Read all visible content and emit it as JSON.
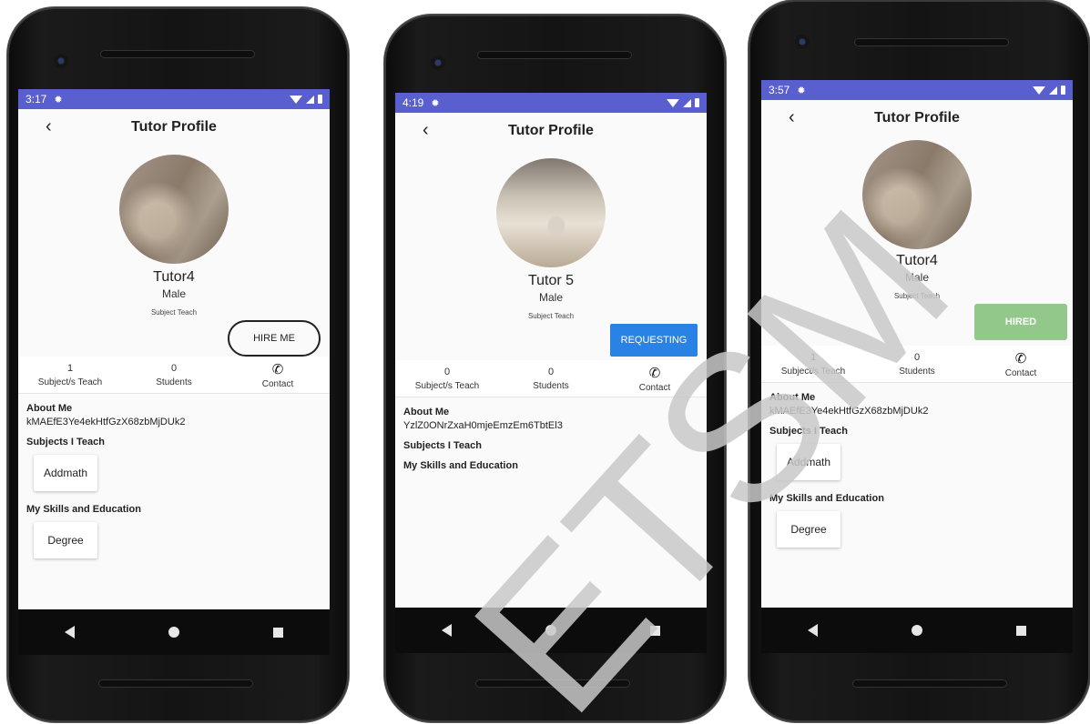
{
  "phones": [
    {
      "time": "3:17",
      "title": "Tutor Profile",
      "name": "Tutor4",
      "gender": "Male",
      "subject_teach": "Subject Teach",
      "action": {
        "label": "HIRE ME",
        "style": "outline"
      },
      "stats": {
        "subjects_value": "1",
        "subjects_label": "Subject/s Teach",
        "students_value": "0",
        "students_label": "Students",
        "contact_label": "Contact"
      },
      "about_title": "About Me",
      "about_text": "kMAEfE3Ye4ekHtfGzX68zbMjDUk2",
      "subjects_title": "Subjects I Teach",
      "subjects": [
        "Addmath"
      ],
      "skills_title": "My Skills and Education",
      "skills": [
        "Degree"
      ]
    },
    {
      "time": "4:19",
      "title": "Tutor Profile",
      "name": "Tutor 5",
      "gender": "Male",
      "subject_teach": "Subject Teach",
      "action": {
        "label": "REQUESTING",
        "style": "blue"
      },
      "stats": {
        "subjects_value": "0",
        "subjects_label": "Subject/s Teach",
        "students_value": "0",
        "students_label": "Students",
        "contact_label": "Contact"
      },
      "about_title": "About Me",
      "about_text": "YzlZ0ONrZxaH0mjeEmzEm6TbtEl3",
      "subjects_title": "Subjects I Teach",
      "subjects": [],
      "skills_title": "My Skills and Education",
      "skills": []
    },
    {
      "time": "3:57",
      "title": "Tutor Profile",
      "name": "Tutor4",
      "gender": "Male",
      "subject_teach": "Subject Teach",
      "action": {
        "label": "HIRED",
        "style": "green"
      },
      "stats": {
        "subjects_value": "1",
        "subjects_label": "Subject/s Teach",
        "students_value": "0",
        "students_label": "Students",
        "contact_label": "Contact"
      },
      "about_title": "About Me",
      "about_text": "kMAEfE3Ye4ekHtfGzX68zbMjDUk2",
      "subjects_title": "Subjects I Teach",
      "subjects": [
        "Addmath"
      ],
      "skills_title": "My Skills and Education",
      "skills": [
        "Degree"
      ]
    }
  ],
  "watermark": {
    "text": "ETSM",
    "color": "#c8c8c8"
  }
}
